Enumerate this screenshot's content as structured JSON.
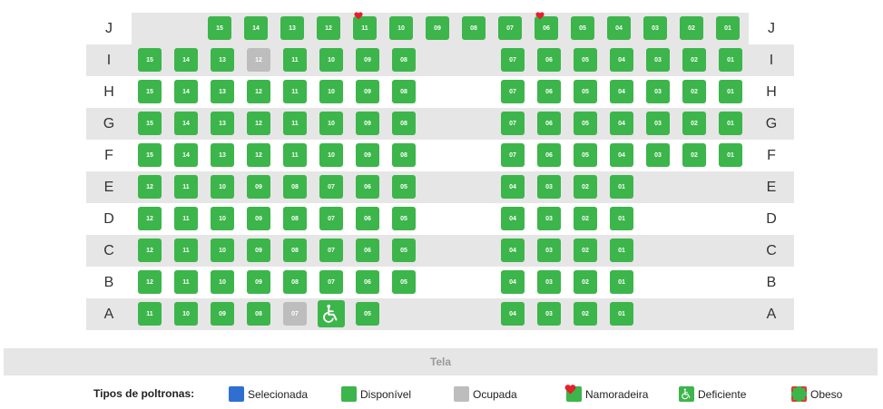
{
  "colors": {
    "available": "#3cb54b",
    "occupied": "#bdbdbd",
    "selected": "#2f6fd1",
    "heart": "#e3202b",
    "obese_border": "#e03a2e"
  },
  "rows": [
    {
      "label": "J",
      "seats": [
        {
          "n": "15"
        },
        {
          "n": "14"
        },
        {
          "n": "13"
        },
        {
          "n": "12"
        },
        {
          "n": "11",
          "type": "couple"
        },
        {
          "n": "10"
        },
        {
          "n": "09"
        },
        {
          "n": "08"
        },
        {
          "n": "07"
        },
        {
          "n": "06",
          "type": "couple"
        },
        {
          "n": "05"
        },
        {
          "n": "04"
        },
        {
          "n": "03"
        },
        {
          "n": "02"
        },
        {
          "n": "01"
        }
      ]
    },
    {
      "label": "I",
      "seats": [
        {
          "n": "15"
        },
        {
          "n": "14"
        },
        {
          "n": "13"
        },
        {
          "n": "12",
          "type": "occupied"
        },
        {
          "n": "11"
        },
        {
          "n": "10"
        },
        {
          "n": "09"
        },
        {
          "n": "08"
        },
        {
          "n": "07"
        },
        {
          "n": "06"
        },
        {
          "n": "05"
        },
        {
          "n": "04"
        },
        {
          "n": "03"
        },
        {
          "n": "02"
        },
        {
          "n": "01"
        }
      ]
    },
    {
      "label": "H",
      "seats": [
        {
          "n": "15"
        },
        {
          "n": "14"
        },
        {
          "n": "13"
        },
        {
          "n": "12"
        },
        {
          "n": "11"
        },
        {
          "n": "10"
        },
        {
          "n": "09"
        },
        {
          "n": "08"
        },
        {
          "n": "07"
        },
        {
          "n": "06"
        },
        {
          "n": "05"
        },
        {
          "n": "04"
        },
        {
          "n": "03"
        },
        {
          "n": "02"
        },
        {
          "n": "01"
        }
      ]
    },
    {
      "label": "G",
      "seats": [
        {
          "n": "15"
        },
        {
          "n": "14"
        },
        {
          "n": "13"
        },
        {
          "n": "12"
        },
        {
          "n": "11"
        },
        {
          "n": "10"
        },
        {
          "n": "09"
        },
        {
          "n": "08"
        },
        {
          "n": "07"
        },
        {
          "n": "06"
        },
        {
          "n": "05"
        },
        {
          "n": "04"
        },
        {
          "n": "03"
        },
        {
          "n": "02"
        },
        {
          "n": "01"
        }
      ]
    },
    {
      "label": "F",
      "seats": [
        {
          "n": "15"
        },
        {
          "n": "14"
        },
        {
          "n": "13"
        },
        {
          "n": "12"
        },
        {
          "n": "11"
        },
        {
          "n": "10"
        },
        {
          "n": "09"
        },
        {
          "n": "08"
        },
        {
          "n": "07"
        },
        {
          "n": "06"
        },
        {
          "n": "05"
        },
        {
          "n": "04"
        },
        {
          "n": "03"
        },
        {
          "n": "02"
        },
        {
          "n": "01"
        }
      ]
    },
    {
      "label": "E",
      "seats": [
        {
          "n": "12"
        },
        {
          "n": "11"
        },
        {
          "n": "10"
        },
        {
          "n": "09"
        },
        {
          "n": "08"
        },
        {
          "n": "07"
        },
        {
          "n": "06"
        },
        {
          "n": "05"
        },
        {
          "n": "04"
        },
        {
          "n": "03"
        },
        {
          "n": "02"
        },
        {
          "n": "01"
        }
      ]
    },
    {
      "label": "D",
      "seats": [
        {
          "n": "12"
        },
        {
          "n": "11"
        },
        {
          "n": "10"
        },
        {
          "n": "09"
        },
        {
          "n": "08"
        },
        {
          "n": "07"
        },
        {
          "n": "06"
        },
        {
          "n": "05"
        },
        {
          "n": "04"
        },
        {
          "n": "03"
        },
        {
          "n": "02"
        },
        {
          "n": "01"
        }
      ]
    },
    {
      "label": "C",
      "seats": [
        {
          "n": "12"
        },
        {
          "n": "11"
        },
        {
          "n": "10"
        },
        {
          "n": "09"
        },
        {
          "n": "08"
        },
        {
          "n": "07"
        },
        {
          "n": "06"
        },
        {
          "n": "05"
        },
        {
          "n": "04"
        },
        {
          "n": "03"
        },
        {
          "n": "02"
        },
        {
          "n": "01"
        }
      ]
    },
    {
      "label": "B",
      "seats": [
        {
          "n": "12"
        },
        {
          "n": "11"
        },
        {
          "n": "10"
        },
        {
          "n": "09"
        },
        {
          "n": "08"
        },
        {
          "n": "07"
        },
        {
          "n": "06"
        },
        {
          "n": "05"
        },
        {
          "n": "04"
        },
        {
          "n": "03"
        },
        {
          "n": "02"
        },
        {
          "n": "01"
        }
      ]
    },
    {
      "label": "A",
      "seats": [
        {
          "n": "11"
        },
        {
          "n": "10"
        },
        {
          "n": "09"
        },
        {
          "n": "08"
        },
        {
          "n": "07",
          "type": "occupied"
        },
        {
          "n": "",
          "type": "wheelchair"
        },
        {
          "n": "05"
        },
        {
          "n": "04"
        },
        {
          "n": "03"
        },
        {
          "n": "02"
        },
        {
          "n": "01"
        }
      ]
    }
  ],
  "screen_label": "Tela",
  "legend": {
    "title": "Tipos de poltronas:",
    "items": [
      {
        "key": "selected",
        "label": "Selecionada",
        "icon": "selected-seat-icon"
      },
      {
        "key": "available",
        "label": "Disponível",
        "icon": "available-seat-icon"
      },
      {
        "key": "occupied",
        "label": "Ocupada",
        "icon": "occupied-seat-icon"
      },
      {
        "key": "couple",
        "label": "Namoradeira",
        "icon": "couple-seat-icon"
      },
      {
        "key": "wheelchair",
        "label": "Deficiente",
        "icon": "wheelchair-seat-icon"
      },
      {
        "key": "obese",
        "label": "Obeso",
        "icon": "obese-seat-icon"
      }
    ]
  }
}
